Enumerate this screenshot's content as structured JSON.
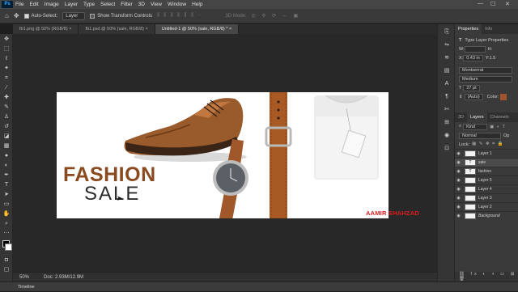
{
  "menubar": {
    "app_icon": "Ps",
    "items": [
      "File",
      "Edit",
      "Image",
      "Layer",
      "Type",
      "Select",
      "Filter",
      "3D",
      "View",
      "Window",
      "Help"
    ]
  },
  "options": {
    "auto_select": "Auto-Select:",
    "auto_select_value": "Layer",
    "show_transform": "Show Transform Controls",
    "mode_3d": "3D Mode:"
  },
  "tabs": [
    {
      "label": "fb1.png @ 50% (RGB/8)",
      "active": false
    },
    {
      "label": "fb1.psd @ 50% (sale, RGB/8)",
      "active": false
    },
    {
      "label": "Untitled-1 @ 50% (sale, RGB/8) *",
      "active": true
    }
  ],
  "tools": [
    "move-icon",
    "marquee-icon",
    "lasso-icon",
    "magic-wand-icon",
    "crop-icon",
    "eyedropper-icon",
    "healing-icon",
    "brush-icon",
    "stamp-icon",
    "history-brush-icon",
    "eraser-icon",
    "gradient-icon",
    "blur-icon",
    "dodge-icon",
    "pen-icon",
    "type-icon",
    "path-select-icon",
    "shape-icon",
    "hand-icon",
    "zoom-icon"
  ],
  "canvas": {
    "fashion_text": "FASHION",
    "sale_text": "SALE",
    "fashion_color": "#8a4a1f",
    "sale_color": "#2c2c2c"
  },
  "watermark": "AAMIR SHAHZAD",
  "status": {
    "zoom": "50%",
    "doc": "Doc: 2.93M/12.9M"
  },
  "timeline": "Timeline",
  "properties": {
    "tabs": [
      "Properties",
      "Info"
    ],
    "section": "Type Layer Properties",
    "w_label": "W:",
    "h_label": "H:",
    "x_label": "X:",
    "x_value": "0.43 in",
    "y_label": "Y:",
    "y_value": "1.5",
    "font": "Montserrat",
    "style": "Medium",
    "size": "27 pt",
    "leading": "(Auto)",
    "color_label": "Color:",
    "color_value": "#a0522d"
  },
  "layers_panel": {
    "tabs": [
      "3D",
      "Layers",
      "Channels"
    ],
    "filter": "Kind",
    "blend": "Normal",
    "opacity": "Op",
    "lock": "Lock:",
    "layers": [
      {
        "name": "Layer 1",
        "type": "image",
        "selected": false
      },
      {
        "name": "sale",
        "type": "text",
        "selected": true
      },
      {
        "name": "fashion",
        "type": "text",
        "selected": false
      },
      {
        "name": "Layer 5",
        "type": "image",
        "selected": false
      },
      {
        "name": "Layer 4",
        "type": "image",
        "selected": false
      },
      {
        "name": "Layer 3",
        "type": "image",
        "selected": false
      },
      {
        "name": "Layer 2",
        "type": "image",
        "selected": false
      },
      {
        "name": "Background",
        "type": "image",
        "selected": false
      }
    ]
  }
}
